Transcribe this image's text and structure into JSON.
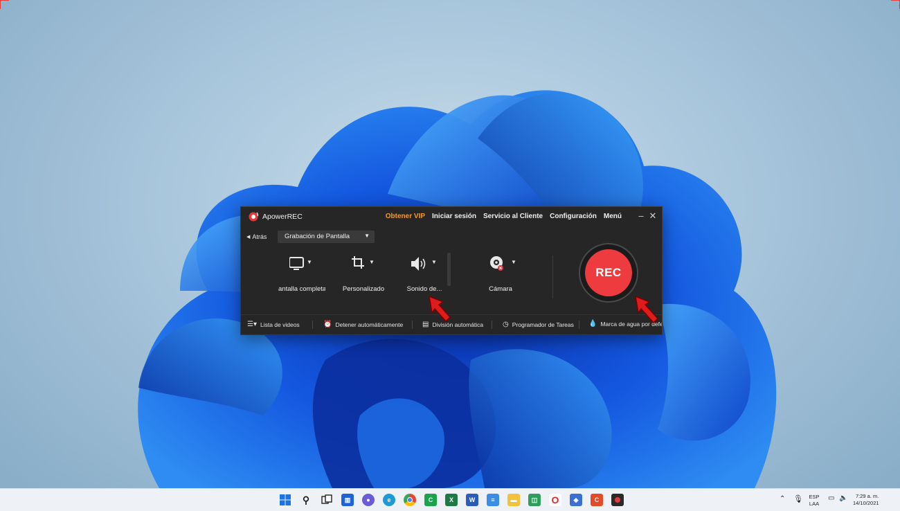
{
  "app": {
    "title": "ApowerREC",
    "nav": {
      "vip": "Obtener VIP",
      "login": "Iniciar sesión",
      "support": "Servicio al Cliente",
      "settings": "Configuración",
      "menu": "Menú"
    },
    "back_label": "Atrás",
    "mode_selected": "Grabación de Pantalla",
    "tools": {
      "full_screen": "antalla completa",
      "custom": "Personalizado",
      "sound": "Sonido de...",
      "camera": "Cámara"
    },
    "rec_label": "REC",
    "bottom": {
      "video_list": "Lista de videos",
      "auto_stop": "Detener automáticamente",
      "auto_split": "División automática",
      "scheduler": "Programador de Tareas",
      "watermark": "Marca de agua por defecto"
    },
    "colors": {
      "accent_vip": "#f39a2c",
      "rec_red": "#ee3b3f",
      "window_bg": "#262626"
    }
  },
  "taskbar": {
    "icons": [
      "windows-start-icon",
      "search-icon",
      "task-view-icon",
      "widgets-icon",
      "chat-icon",
      "edge-icon",
      "chrome-icon",
      "camtasia-icon",
      "excel-icon",
      "word-icon",
      "notepad-icon",
      "file-explorer-icon",
      "snipping-icon",
      "opera-icon",
      "app-icon",
      "camtasia-recorder-icon",
      "apowerrec-icon"
    ],
    "tray": {
      "lang": "ESP",
      "layout": "LAA",
      "time": "7:29 a. m.",
      "date": "14/10/2021"
    }
  }
}
